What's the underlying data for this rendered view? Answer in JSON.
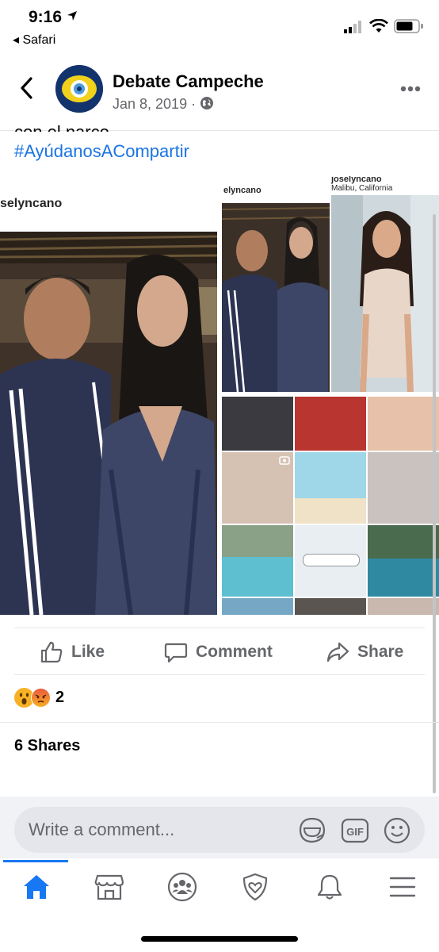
{
  "status_bar": {
    "time": "9:16",
    "back_app": "◂ Safari"
  },
  "post": {
    "page_name": "Debate Campeche",
    "date": "Jan 8, 2019 ·",
    "caption_cut": "con el narco . . .",
    "hashtag": "#AyúdanosACompartir",
    "left_photo_username": "selyncano",
    "right_photo_username": "elyncano",
    "ig_profile": {
      "username": "joselyncano",
      "location": "Malibu, California"
    }
  },
  "actions": {
    "like": "Like",
    "comment": "Comment",
    "share": "Share"
  },
  "reactions": {
    "count": "2",
    "types": [
      "wow",
      "angry"
    ]
  },
  "shares": "6 Shares",
  "comment_input": {
    "placeholder": "Write a comment..."
  },
  "nav": {
    "items": [
      "home-icon",
      "marketplace-icon",
      "groups-icon",
      "protect-icon",
      "notifications-icon",
      "menu-icon"
    ],
    "active": "home-icon"
  },
  "colors": {
    "facebook_blue": "#1877f2",
    "link_blue": "#1b74e4",
    "text_secondary": "#65676b"
  }
}
